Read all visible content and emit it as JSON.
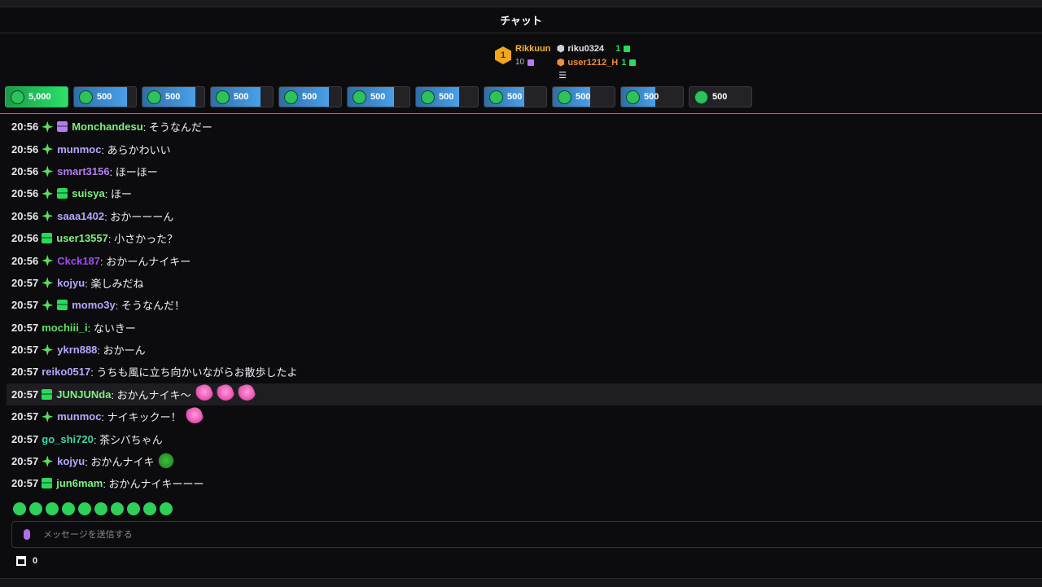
{
  "header": {
    "title": "チャット"
  },
  "leaderboard": {
    "first": {
      "rank": "1",
      "name": "Rikkuun",
      "count": "10"
    },
    "others": [
      {
        "name": "riku0324",
        "count": "1",
        "color": "#e6e6e8"
      },
      {
        "name": "user1212_H",
        "count": "1",
        "color": "#f08c3a"
      }
    ]
  },
  "pinned": [
    {
      "amount": "5,000",
      "fill": 1.0,
      "first": true
    },
    {
      "amount": "500",
      "fill": 0.85
    },
    {
      "amount": "500",
      "fill": 0.85
    },
    {
      "amount": "500",
      "fill": 0.8
    },
    {
      "amount": "500",
      "fill": 0.8
    },
    {
      "amount": "500",
      "fill": 0.75
    },
    {
      "amount": "500",
      "fill": 0.7
    },
    {
      "amount": "500",
      "fill": 0.65
    },
    {
      "amount": "500",
      "fill": 0.6
    },
    {
      "amount": "500",
      "fill": 0.55
    },
    {
      "amount": "500",
      "fill": 0.0
    }
  ],
  "messages": [
    {
      "time": "20:56",
      "sparkle": true,
      "gift": "purple",
      "user": "Monchandesu",
      "color": "#7ef07e",
      "text": ": そうなんだー"
    },
    {
      "time": "20:56",
      "sparkle": true,
      "gift": "",
      "user": "munmoc",
      "color": "#b9a6ff",
      "text": ": あらかわいい"
    },
    {
      "time": "20:56",
      "sparkle": true,
      "gift": "",
      "user": "smart3156",
      "color": "#b57cf2",
      "text": ": ほーほー"
    },
    {
      "time": "20:56",
      "sparkle": true,
      "gift": "green",
      "user": "suisya",
      "color": "#7ef07e",
      "text": ": ほー"
    },
    {
      "time": "20:56",
      "sparkle": true,
      "gift": "",
      "user": "saaa1402",
      "color": "#b9a6ff",
      "text": ": おかーーーん"
    },
    {
      "time": "20:56",
      "sparkle": false,
      "gift": "green",
      "user": "user13557",
      "color": "#7ef07e",
      "text": ": 小さかった？"
    },
    {
      "time": "20:56",
      "sparkle": true,
      "gift": "",
      "user": "Ckck187",
      "color": "#a44af0",
      "text": ": おかーんナイキー"
    },
    {
      "time": "20:57",
      "sparkle": true,
      "gift": "",
      "user": "kojyu",
      "color": "#b9a6ff",
      "text": ": 楽しみだね"
    },
    {
      "time": "20:57",
      "sparkle": true,
      "gift": "green",
      "user": "momo3y",
      "color": "#b9a6ff",
      "text": ": そうなんだ！"
    },
    {
      "time": "20:57",
      "sparkle": false,
      "gift": "",
      "user": "mochiii_i",
      "color": "#5ee06a",
      "text": ": ないきー"
    },
    {
      "time": "20:57",
      "sparkle": true,
      "gift": "",
      "user": "ykrn888",
      "color": "#b9a6ff",
      "text": ": おかーん"
    },
    {
      "time": "20:57",
      "sparkle": false,
      "gift": "",
      "user": "reiko0517",
      "color": "#b9a6ff",
      "text": ": うちも風に立ち向かいながらお散歩したよ"
    },
    {
      "time": "20:57",
      "sparkle": false,
      "gift": "green",
      "user": "JUNJUNda",
      "color": "#7ef07e",
      "text": ": おかんナイキ〜",
      "emotes": [
        "pink",
        "pink",
        "pink"
      ],
      "highlight": true
    },
    {
      "time": "20:57",
      "sparkle": true,
      "gift": "",
      "user": "munmoc",
      "color": "#b9a6ff",
      "text": ": ナイキックー！",
      "emotes": [
        "pink"
      ]
    },
    {
      "time": "20:57",
      "sparkle": false,
      "gift": "",
      "user": "go_shi720",
      "color": "#3fd6a8",
      "text": ": 茶シバちゃん"
    },
    {
      "time": "20:57",
      "sparkle": true,
      "gift": "",
      "user": "kojyu",
      "color": "#b9a6ff",
      "text": ": おかんナイキ",
      "emotes": [
        "frog"
      ]
    },
    {
      "time": "20:57",
      "sparkle": false,
      "gift": "green",
      "user": "jun6mam",
      "color": "#7ef07e",
      "text": ": おかんナイキーーー"
    }
  ],
  "emote_bar_count": 10,
  "input": {
    "placeholder": "メッセージを送信する"
  },
  "footer": {
    "points": "0"
  }
}
